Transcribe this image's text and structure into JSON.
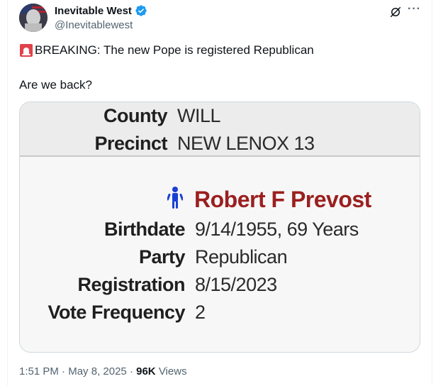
{
  "author": {
    "name": "Inevitable West",
    "handle": "@Inevitablewest"
  },
  "tweet": {
    "line1": "BREAKING: The new Pope is registered Republican",
    "line2": "Are we back?"
  },
  "card": {
    "county_label": "County",
    "county_value": "WILL",
    "precinct_label": "Precinct",
    "precinct_value": "NEW LENOX 13",
    "voter_name": "Robert F Prevost",
    "birthdate_label": "Birthdate",
    "birthdate_value": "9/14/1955, 69 Years",
    "party_label": "Party",
    "party_value": "Republican",
    "registration_label": "Registration",
    "registration_value": "8/15/2023",
    "vote_frequency_label": "Vote Frequency",
    "vote_frequency_value": "2"
  },
  "meta": {
    "time": "1:51 PM",
    "date": "May 8, 2025",
    "views_count": "96K",
    "views_label": "Views"
  },
  "colors": {
    "verified": "#1d9bf0",
    "name_red": "#9b1f1f",
    "person_icon": "#1a3fd6"
  }
}
